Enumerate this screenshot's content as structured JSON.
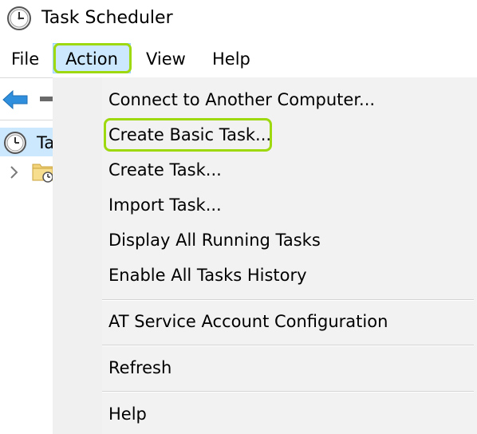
{
  "window": {
    "title": "Task Scheduler"
  },
  "menubar": {
    "items": [
      {
        "label": "File"
      },
      {
        "label": "Action"
      },
      {
        "label": "View"
      },
      {
        "label": "Help"
      }
    ],
    "active": "Action"
  },
  "tree": {
    "root_label_visible": "Ta"
  },
  "dropdown": {
    "items": [
      {
        "label": "Connect to Another Computer..."
      },
      {
        "label": "Create Basic Task..."
      },
      {
        "label": "Create Task..."
      },
      {
        "label": "Import Task..."
      },
      {
        "label": "Display All Running Tasks"
      },
      {
        "label": "Enable All Tasks History"
      },
      {
        "label": "AT Service Account Configuration"
      },
      {
        "label": "Refresh"
      },
      {
        "label": "Help"
      }
    ],
    "highlighted": "Create Basic Task..."
  },
  "colors": {
    "highlight_outline": "#9ed80e",
    "menu_active_bg": "#cce8ff",
    "dropdown_bg": "#f2f2f2",
    "back_arrow": "#2f8fdc"
  },
  "icons": {
    "title": "clock-icon",
    "back": "back-arrow-icon",
    "tree_root": "clock-icon",
    "tree_child": "folder-clock-icon",
    "tree_expand": "chevron-right-icon"
  }
}
